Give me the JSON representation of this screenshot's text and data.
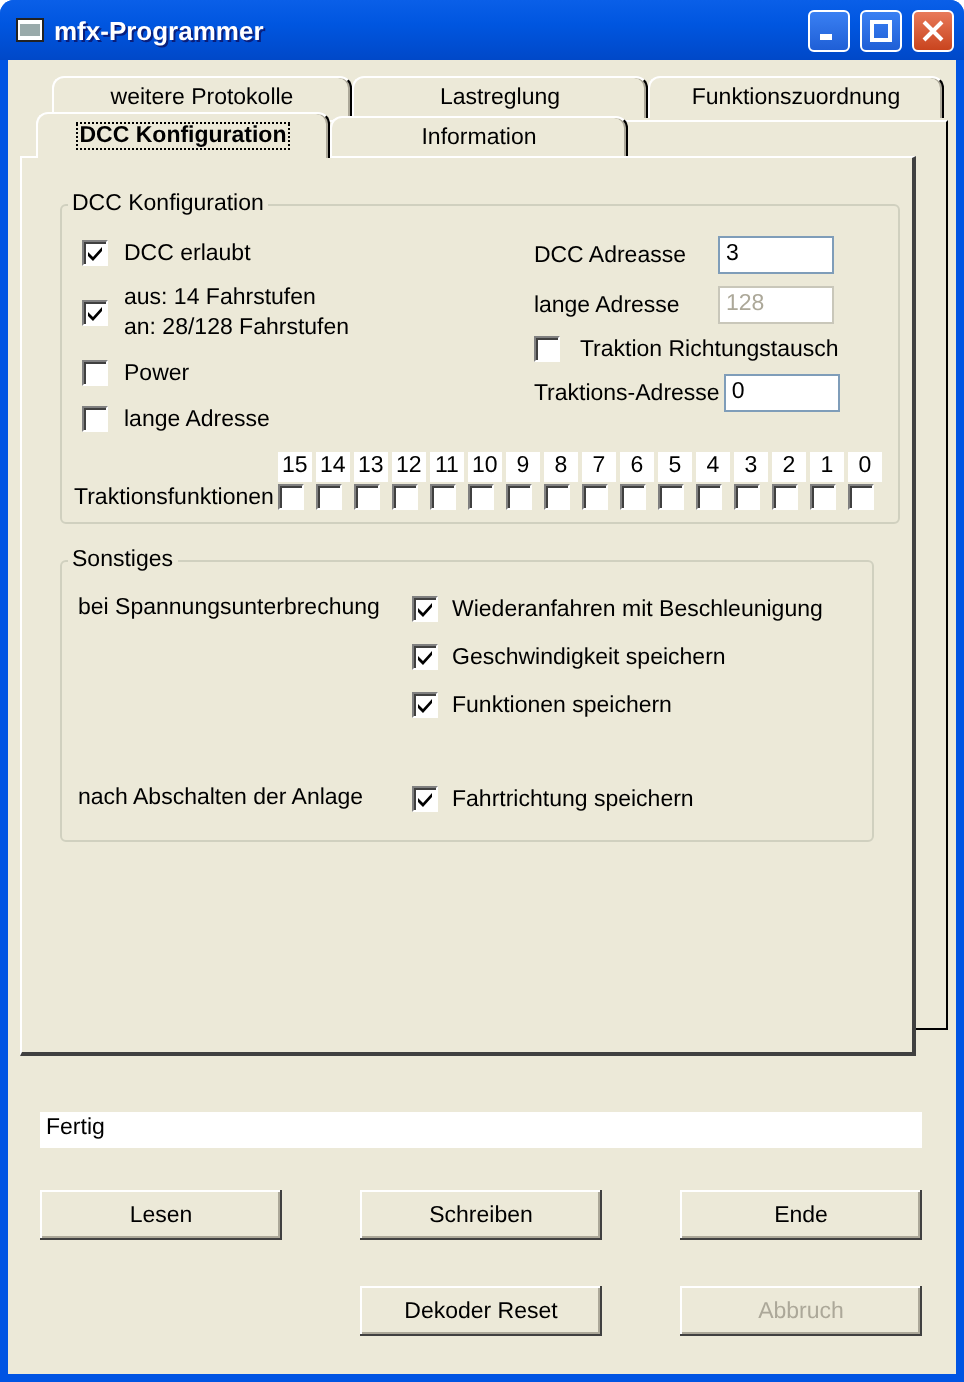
{
  "window": {
    "title": "mfx-Programmer"
  },
  "tab_rows": [
    [
      {
        "label": "weitere Protokolle",
        "selected": false
      },
      {
        "label": "Lastreglung",
        "selected": false
      },
      {
        "label": "Funktionszuordnung",
        "selected": false
      }
    ],
    [
      {
        "label": "DCC Konfiguration",
        "selected": true
      },
      {
        "label": "Information",
        "selected": false
      }
    ]
  ],
  "dcc_group": {
    "title": "DCC Konfiguration",
    "left": [
      {
        "lines": [
          "DCC erlaubt"
        ],
        "checked": true
      },
      {
        "lines": [
          "aus: 14 Fahrstufen",
          "an: 28/128 Fahrstufen"
        ],
        "checked": true
      },
      {
        "lines": [
          "Power"
        ],
        "checked": false
      },
      {
        "lines": [
          "lange Adresse"
        ],
        "checked": false
      }
    ],
    "right": [
      {
        "kind": "field",
        "label": "DCC Adreasse",
        "value": "3",
        "disabled": false
      },
      {
        "kind": "field",
        "label": "lange Adresse",
        "value": "128",
        "disabled": true
      },
      {
        "kind": "checkbox",
        "label": "Traktion Richtungstausch",
        "checked": false
      },
      {
        "kind": "field",
        "label": "Traktions-Adresse",
        "value": "0",
        "disabled": false
      }
    ],
    "functions": {
      "label": "Traktionsfunktionen",
      "bits": [
        {
          "number": "15",
          "checked": false
        },
        {
          "number": "14",
          "checked": false
        },
        {
          "number": "13",
          "checked": false
        },
        {
          "number": "12",
          "checked": false
        },
        {
          "number": "11",
          "checked": false
        },
        {
          "number": "10",
          "checked": false
        },
        {
          "number": "9",
          "checked": false
        },
        {
          "number": "8",
          "checked": false
        },
        {
          "number": "7",
          "checked": false
        },
        {
          "number": "6",
          "checked": false
        },
        {
          "number": "5",
          "checked": false
        },
        {
          "number": "4",
          "checked": false
        },
        {
          "number": "3",
          "checked": false
        },
        {
          "number": "2",
          "checked": false
        },
        {
          "number": "1",
          "checked": false
        },
        {
          "number": "0",
          "checked": false
        }
      ]
    }
  },
  "other_group": {
    "title": "Sonstiges",
    "rows": [
      {
        "label": "bei Spannungsunterbrechung",
        "options": [
          {
            "label": "Wiederanfahren mit Beschleunigung",
            "checked": true
          },
          {
            "label": "Geschwindigkeit speichern",
            "checked": true
          },
          {
            "label": "Funktionen speichern",
            "checked": true
          }
        ]
      },
      {
        "label": "nach Abschalten der Anlage",
        "options": [
          {
            "label": "Fahrtrichtung speichern",
            "checked": true
          }
        ]
      }
    ]
  },
  "status_field": {
    "value": "Fertig"
  },
  "button_rows": [
    [
      {
        "label": "Lesen",
        "disabled": false
      },
      {
        "label": "Schreiben",
        "disabled": false
      },
      {
        "label": "Ende",
        "disabled": false
      }
    ],
    [
      {
        "label": "Dekoder Reset",
        "disabled": false
      },
      {
        "label": "Abbruch",
        "disabled": true
      }
    ]
  ]
}
